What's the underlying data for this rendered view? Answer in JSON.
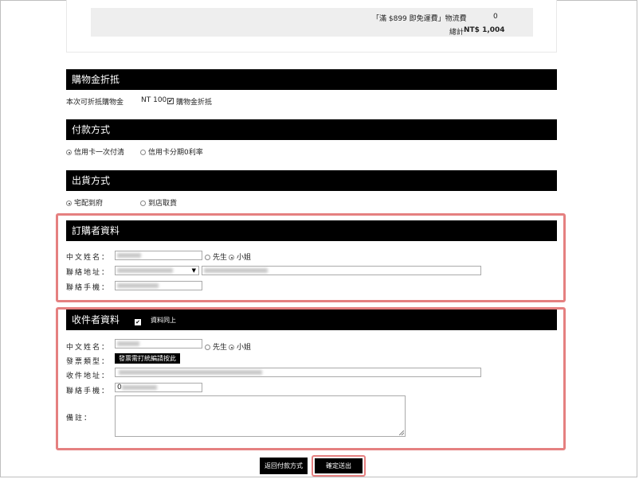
{
  "summary": {
    "shipping_label": "「滿 $899 即免運費」物流費",
    "shipping_value": "0",
    "total_label": "總計",
    "total_value": "NT$ 1,004"
  },
  "discount": {
    "title": "購物金折抵",
    "row_label": "本次可折抵購物金",
    "amount": "NT 100",
    "checkbox_label": "購物金折抵"
  },
  "payment": {
    "title": "付款方式",
    "options": [
      "信用卡一次付清",
      "信用卡分期0利率"
    ]
  },
  "shipping": {
    "title": "出貨方式",
    "options": [
      "宅配到府",
      "到店取貨"
    ]
  },
  "buyer": {
    "title": "訂購者資料",
    "name_label": "中文姓名：",
    "gender_options": [
      "先生",
      "小姐"
    ],
    "address_label": "聯絡地址：",
    "phone_label": "聯絡手機："
  },
  "receiver": {
    "title": "收件者資料",
    "same_label": "資料同上",
    "name_label": "中文姓名：",
    "gender_options": [
      "先生",
      "小姐"
    ],
    "invoice_label": "發票類型：",
    "invoice_button": "發票需打統編請按此",
    "address_label": "收件地址：",
    "phone_label": "聯絡手機：",
    "phone_value": "0",
    "note_label": "備註："
  },
  "actions": {
    "back_label": "返回付款方式",
    "confirm_label": "確定送出"
  },
  "colors": {
    "highlight": "#e58080",
    "bar": "#000000"
  }
}
